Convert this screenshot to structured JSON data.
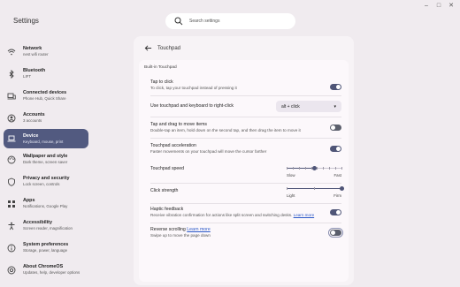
{
  "app": {
    "title": "Settings"
  },
  "window_controls": [
    {
      "name": "minimize-button",
      "glyph": "–"
    },
    {
      "name": "maximize-button",
      "glyph": "□"
    },
    {
      "name": "close-button",
      "glyph": "✕"
    }
  ],
  "search": {
    "placeholder": "Search settings"
  },
  "sidebar": {
    "items": [
      {
        "id": "network",
        "label": "Network",
        "sub": "nest wifi router",
        "icon": "wifi-icon"
      },
      {
        "id": "bluetooth",
        "label": "Bluetooth",
        "sub": "LIFT",
        "icon": "bluetooth-icon"
      },
      {
        "id": "connected-devices",
        "label": "Connected devices",
        "sub": "Phone Hub, Quick Share",
        "icon": "devices-icon"
      },
      {
        "id": "accounts",
        "label": "Accounts",
        "sub": "3 accounts",
        "icon": "account-icon"
      },
      {
        "id": "device",
        "label": "Device",
        "sub": "Keyboard, mouse, print",
        "icon": "laptop-icon",
        "active": true
      },
      {
        "id": "wallpaper",
        "label": "Wallpaper and style",
        "sub": "Dark theme, screen saver",
        "icon": "palette-icon"
      },
      {
        "id": "privacy",
        "label": "Privacy and security",
        "sub": "Lock screen, controls",
        "icon": "shield-icon"
      },
      {
        "id": "apps",
        "label": "Apps",
        "sub": "Notifications, Google Play",
        "icon": "apps-icon"
      },
      {
        "id": "accessibility",
        "label": "Accessibility",
        "sub": "Screen reader, magnification",
        "icon": "accessibility-icon"
      },
      {
        "id": "system",
        "label": "System preferences",
        "sub": "Storage, power, language",
        "icon": "system-icon"
      },
      {
        "id": "about",
        "label": "About ChromeOS",
        "sub": "Updates, help, developer options",
        "icon": "chromeos-icon"
      }
    ]
  },
  "panel": {
    "title": "Touchpad",
    "section_title": "Built-in Touchpad",
    "rows": {
      "tap_to_click": {
        "title": "Tap to click",
        "sub": "To click, tap your touchpad instead of pressing it",
        "on": true
      },
      "right_click": {
        "title": "Use touchpad and keyboard to right-click",
        "value": "alt + click"
      },
      "tap_drag": {
        "title": "Tap and drag to move items",
        "sub": "Double-tap an item, hold down on the second tap, and then drag the item to move it",
        "on": false
      },
      "acceleration": {
        "title": "Touchpad acceleration",
        "sub": "Faster movements on your touchpad will move the cursor farther",
        "on": true
      },
      "speed": {
        "title": "Touchpad speed",
        "min_label": "Slow",
        "max_label": "Fast",
        "value": 0.5,
        "ticks": 10
      },
      "click_strength": {
        "title": "Click strength",
        "min_label": "Light",
        "max_label": "Firm",
        "value": 1.0,
        "ticks": 3
      },
      "haptic": {
        "title": "Haptic feedback",
        "sub": "Receive vibration confirmation for actions like split screen and switching desks.",
        "link": "Learn more",
        "on": true
      },
      "reverse": {
        "title": "Reverse scrolling",
        "link": "Learn more",
        "sub": "Swipe up to move the page down",
        "on": false
      }
    }
  },
  "colors": {
    "accent": "#4f5577",
    "active_nav": "#525a80",
    "link": "#2b58c7",
    "background": "#f0ebef"
  }
}
